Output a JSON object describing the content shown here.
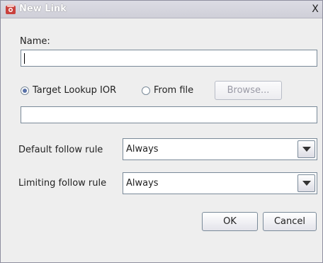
{
  "window": {
    "title": "New Link",
    "close_glyph": "X"
  },
  "form": {
    "name_label": "Name:",
    "name_value": "",
    "radio_target_label": "Target Lookup IOR",
    "radio_file_label": "From file",
    "selected_source": "Target Lookup IOR",
    "browse_label": "Browse...",
    "ior_value": "",
    "default_follow_label": "Default follow rule",
    "default_follow_value": "Always",
    "limiting_follow_label": "Limiting follow rule",
    "limiting_follow_value": "Always"
  },
  "buttons": {
    "ok": "OK",
    "cancel": "Cancel"
  },
  "colors": {
    "title_bar": "#d4d4dc",
    "radio_dot": "#5a72a8",
    "border": "#7a8a99"
  }
}
